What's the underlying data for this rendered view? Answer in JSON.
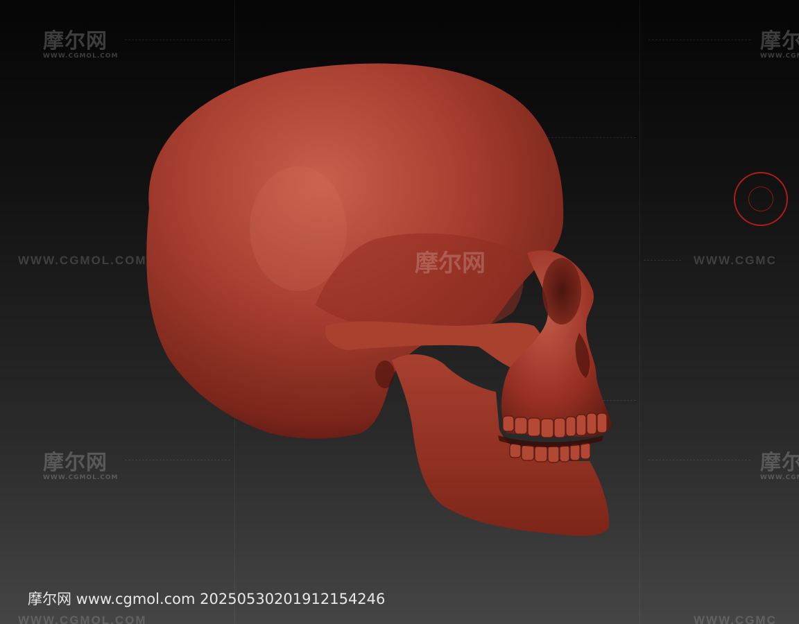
{
  "watermark": {
    "logo_text": "摩尔网",
    "logo_sub": "WWW.CGMOL.COM",
    "url_text": "WWW.CGMOL.COM",
    "url_text_partial": "WWW.CGMC",
    "logo_partial": "摩尔",
    "center_text": "摩尔网"
  },
  "caption": {
    "text": "摩尔网 www.cgmol.com 20250530201912154246"
  },
  "colors": {
    "skull": "#a23a2c",
    "skull_shadow": "#5a1a12",
    "target_ring": "#b21b1b"
  },
  "icons": {
    "skull": "skull-model",
    "target": "transpose-target-icon"
  }
}
